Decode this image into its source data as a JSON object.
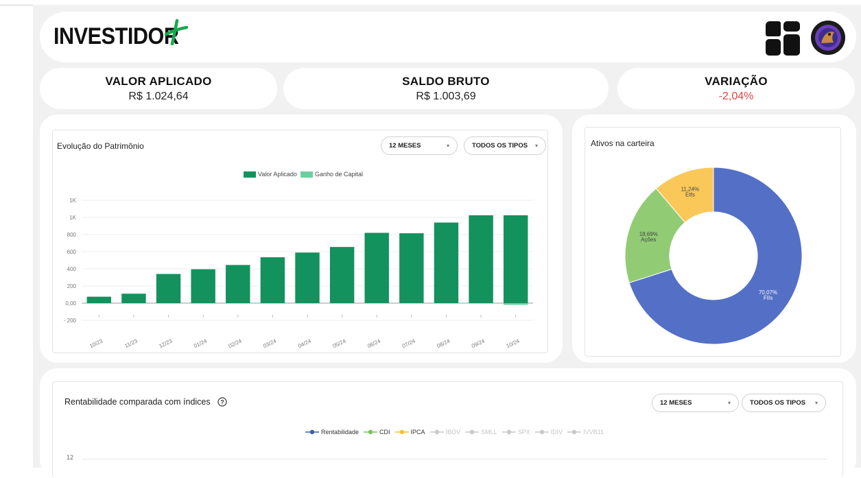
{
  "header": {
    "logo_text": "INVESTIDOR",
    "logo_plus": "+",
    "apps_icon": "grid-apps-icon",
    "avatar_icon": "user-avatar"
  },
  "kpis": [
    {
      "title": "VALOR APLICADO",
      "value": "R$ 1.024,64"
    },
    {
      "title": "SALDO BRUTO",
      "value": "R$ 1.003,69"
    },
    {
      "title": "VARIAÇÃO",
      "value": "-2,04%",
      "color": "#e04444"
    }
  ],
  "evolution": {
    "title": "Evolução do Patrimônio",
    "period_select": "12 MESES",
    "type_select": "TODOS OS TIPOS",
    "legend": [
      {
        "label": "Valor Aplicado",
        "color": "#13925d"
      },
      {
        "label": "Ganho de Capital",
        "color": "#6ccfa1"
      }
    ]
  },
  "portfolio": {
    "title": "Ativos na carteira"
  },
  "comparison": {
    "title": "Rentabilidade comparada com índices",
    "help_icon": "question-circle-icon",
    "period_select": "12 MESES",
    "type_select": "TODOS OS TIPOS",
    "legend": [
      {
        "label": "Rentabilidade",
        "color": "#3b5bab",
        "active": true
      },
      {
        "label": "CDI",
        "color": "#7cc25a",
        "active": true
      },
      {
        "label": "IPCA",
        "color": "#f2c230",
        "active": true
      },
      {
        "label": "IBOV",
        "color": "#c9c9c9",
        "active": false
      },
      {
        "label": "SMLL",
        "color": "#c9c9c9",
        "active": false
      },
      {
        "label": "SPX",
        "color": "#c9c9c9",
        "active": false
      },
      {
        "label": "IDIV",
        "color": "#c9c9c9",
        "active": false
      },
      {
        "label": "IVVB11",
        "color": "#c9c9c9",
        "active": false
      }
    ],
    "y_first_tick": "12"
  },
  "chart_data": [
    {
      "type": "bar",
      "title": "Evolução do Patrimônio",
      "categories": [
        "10/23",
        "11/23",
        "12/23",
        "01/24",
        "02/24",
        "03/24",
        "04/24",
        "05/24",
        "06/24",
        "07/24",
        "08/24",
        "09/24",
        "10/24"
      ],
      "series": [
        {
          "name": "Valor Aplicado",
          "values": [
            75,
            110,
            340,
            395,
            445,
            535,
            590,
            655,
            820,
            815,
            940,
            1025,
            1025
          ]
        },
        {
          "name": "Ganho de Capital",
          "values": [
            0,
            0,
            0,
            0,
            0,
            0,
            0,
            0,
            -2,
            -2,
            0,
            -5,
            -20
          ]
        }
      ],
      "y_ticks": [
        "1K",
        "1K",
        "800",
        "600",
        "400",
        "200",
        "0,00",
        "- 200"
      ],
      "y_tick_values": [
        1200,
        1000,
        800,
        600,
        400,
        200,
        0,
        -200
      ],
      "ylim": [
        -200,
        1200
      ],
      "grid": true,
      "legend": "top"
    },
    {
      "type": "pie",
      "title": "Ativos na carteira",
      "donut": true,
      "slices": [
        {
          "label": "FIIs",
          "value": 70.07,
          "display": "70,07%",
          "color": "#5470c6"
        },
        {
          "label": "Ações",
          "value": 18.69,
          "display": "18,69%",
          "color": "#91cc75"
        },
        {
          "label": "Etfs",
          "value": 11.24,
          "display": "11,24%",
          "color": "#fac858"
        }
      ]
    }
  ]
}
